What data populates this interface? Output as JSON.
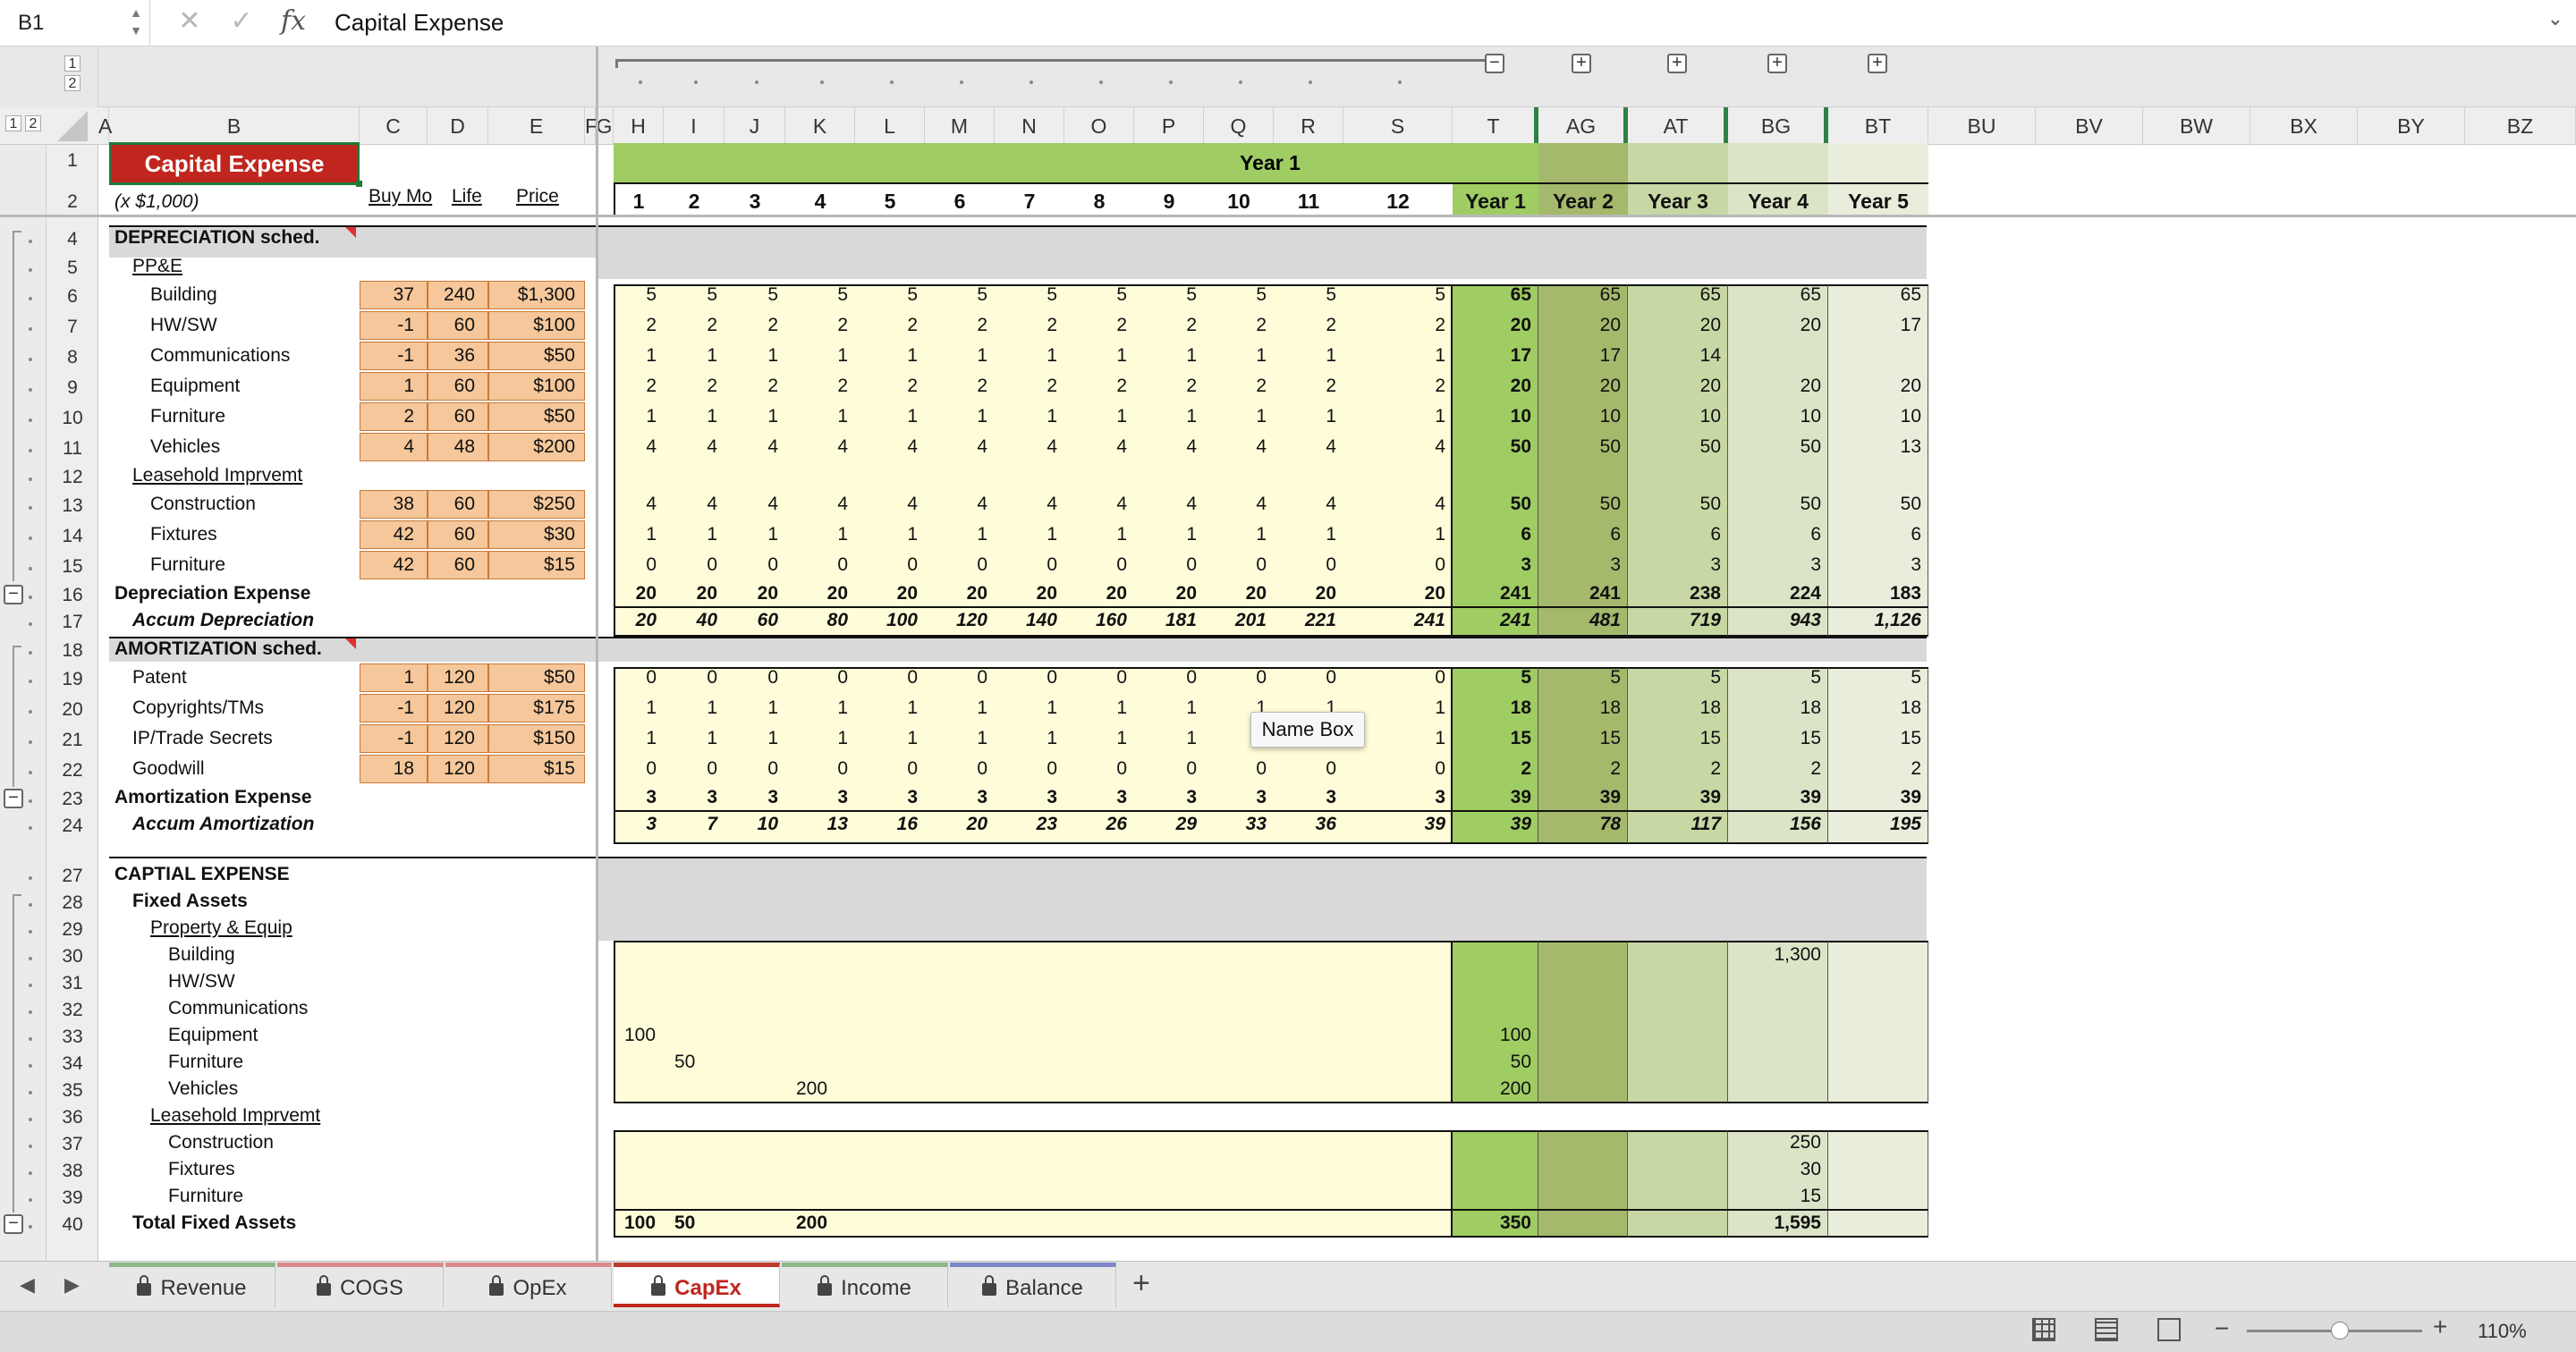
{
  "formula_bar": {
    "name_box": "B1",
    "cancel_icon": "x-icon",
    "enter_icon": "check-icon",
    "fx_label": "fx",
    "content": "Capital Expense"
  },
  "outline_levels": [
    "1",
    "2"
  ],
  "columns": [
    "A",
    "B",
    "C",
    "D",
    "E",
    "F",
    "G",
    "H",
    "I",
    "J",
    "K",
    "L",
    "M",
    "N",
    "O",
    "P",
    "Q",
    "R",
    "S",
    "T",
    "AG",
    "AT",
    "BG",
    "BT",
    "BU",
    "BV",
    "BW",
    "BX",
    "BY",
    "BZ"
  ],
  "rows": [
    "1",
    "2",
    "4",
    "5",
    "6",
    "7",
    "8",
    "9",
    "10",
    "11",
    "12",
    "13",
    "14",
    "15",
    "16",
    "17",
    "18",
    "19",
    "20",
    "21",
    "22",
    "23",
    "24",
    "27",
    "28",
    "29",
    "30",
    "31",
    "32",
    "33",
    "34",
    "35",
    "36",
    "37",
    "38",
    "39",
    "40"
  ],
  "header": {
    "title": "Capital Expense",
    "subtitle": "(x $1,000)",
    "col_buy": "Buy Mo",
    "col_life": "Life",
    "col_price": "Price",
    "year1_banner": "Year 1",
    "months": [
      "1",
      "2",
      "3",
      "4",
      "5",
      "6",
      "7",
      "8",
      "9",
      "10",
      "11",
      "12"
    ],
    "years": [
      "Year 1",
      "Year 2",
      "Year 3",
      "Year 4",
      "Year 5"
    ]
  },
  "depreciation": {
    "section": "DEPRECIATION sched.",
    "ppe_label": "PP&E",
    "leasehold_label": "Leasehold Imprvemt",
    "items": [
      {
        "row": "6",
        "label": "Building",
        "buy": "37",
        "life": "240",
        "price": "$1,300",
        "m": [
          "5",
          "5",
          "5",
          "5",
          "5",
          "5",
          "5",
          "5",
          "5",
          "5",
          "5",
          "5"
        ],
        "y": [
          "65",
          "65",
          "65",
          "65",
          "65"
        ]
      },
      {
        "row": "7",
        "label": "HW/SW",
        "buy": "-1",
        "life": "60",
        "price": "$100",
        "m": [
          "2",
          "2",
          "2",
          "2",
          "2",
          "2",
          "2",
          "2",
          "2",
          "2",
          "2",
          "2"
        ],
        "y": [
          "20",
          "20",
          "20",
          "20",
          "17"
        ]
      },
      {
        "row": "8",
        "label": "Communications",
        "buy": "-1",
        "life": "36",
        "price": "$50",
        "m": [
          "1",
          "1",
          "1",
          "1",
          "1",
          "1",
          "1",
          "1",
          "1",
          "1",
          "1",
          "1"
        ],
        "y": [
          "17",
          "17",
          "14",
          "",
          ""
        ]
      },
      {
        "row": "9",
        "label": "Equipment",
        "buy": "1",
        "life": "60",
        "price": "$100",
        "m": [
          "2",
          "2",
          "2",
          "2",
          "2",
          "2",
          "2",
          "2",
          "2",
          "2",
          "2",
          "2"
        ],
        "y": [
          "20",
          "20",
          "20",
          "20",
          "20"
        ]
      },
      {
        "row": "10",
        "label": "Furniture",
        "buy": "2",
        "life": "60",
        "price": "$50",
        "m": [
          "1",
          "1",
          "1",
          "1",
          "1",
          "1",
          "1",
          "1",
          "1",
          "1",
          "1",
          "1"
        ],
        "y": [
          "10",
          "10",
          "10",
          "10",
          "10"
        ]
      },
      {
        "row": "11",
        "label": "Vehicles",
        "buy": "4",
        "life": "48",
        "price": "$200",
        "m": [
          "4",
          "4",
          "4",
          "4",
          "4",
          "4",
          "4",
          "4",
          "4",
          "4",
          "4",
          "4"
        ],
        "y": [
          "50",
          "50",
          "50",
          "50",
          "13"
        ]
      },
      {
        "row": "13",
        "label": "Construction",
        "buy": "38",
        "life": "60",
        "price": "$250",
        "m": [
          "4",
          "4",
          "4",
          "4",
          "4",
          "4",
          "4",
          "4",
          "4",
          "4",
          "4",
          "4"
        ],
        "y": [
          "50",
          "50",
          "50",
          "50",
          "50"
        ]
      },
      {
        "row": "14",
        "label": "Fixtures",
        "buy": "42",
        "life": "60",
        "price": "$30",
        "m": [
          "1",
          "1",
          "1",
          "1",
          "1",
          "1",
          "1",
          "1",
          "1",
          "1",
          "1",
          "1"
        ],
        "y": [
          "6",
          "6",
          "6",
          "6",
          "6"
        ]
      },
      {
        "row": "15",
        "label": "Furniture",
        "buy": "42",
        "life": "60",
        "price": "$15",
        "m": [
          "0",
          "0",
          "0",
          "0",
          "0",
          "0",
          "0",
          "0",
          "0",
          "0",
          "0",
          "0"
        ],
        "y": [
          "3",
          "3",
          "3",
          "3",
          "3"
        ]
      }
    ],
    "total": {
      "label": "Depreciation Expense",
      "m": [
        "20",
        "20",
        "20",
        "20",
        "20",
        "20",
        "20",
        "20",
        "20",
        "20",
        "20",
        "20"
      ],
      "y": [
        "241",
        "241",
        "238",
        "224",
        "183"
      ]
    },
    "accum": {
      "label": "Accum Depreciation",
      "m": [
        "20",
        "40",
        "60",
        "80",
        "100",
        "120",
        "140",
        "160",
        "181",
        "201",
        "221",
        "241"
      ],
      "y": [
        "241",
        "481",
        "719",
        "943",
        "1,126"
      ]
    }
  },
  "amortization": {
    "section": "AMORTIZATION sched.",
    "items": [
      {
        "row": "19",
        "label": "Patent",
        "buy": "1",
        "life": "120",
        "price": "$50",
        "m": [
          "0",
          "0",
          "0",
          "0",
          "0",
          "0",
          "0",
          "0",
          "0",
          "0",
          "0",
          "0"
        ],
        "y": [
          "5",
          "5",
          "5",
          "5",
          "5"
        ]
      },
      {
        "row": "20",
        "label": "Copyrights/TMs",
        "buy": "-1",
        "life": "120",
        "price": "$175",
        "m": [
          "1",
          "1",
          "1",
          "1",
          "1",
          "1",
          "1",
          "1",
          "1",
          "1",
          "1",
          "1"
        ],
        "y": [
          "18",
          "18",
          "18",
          "18",
          "18"
        ]
      },
      {
        "row": "21",
        "label": "IP/Trade Secrets",
        "buy": "-1",
        "life": "120",
        "price": "$150",
        "m": [
          "1",
          "1",
          "1",
          "1",
          "1",
          "1",
          "1",
          "1",
          "1",
          "1",
          "1",
          "1"
        ],
        "y": [
          "15",
          "15",
          "15",
          "15",
          "15"
        ]
      },
      {
        "row": "22",
        "label": "Goodwill",
        "buy": "18",
        "life": "120",
        "price": "$15",
        "m": [
          "0",
          "0",
          "0",
          "0",
          "0",
          "0",
          "0",
          "0",
          "0",
          "0",
          "0",
          "0"
        ],
        "y": [
          "2",
          "2",
          "2",
          "2",
          "2"
        ]
      }
    ],
    "total": {
      "label": "Amortization Expense",
      "m": [
        "3",
        "3",
        "3",
        "3",
        "3",
        "3",
        "3",
        "3",
        "3",
        "3",
        "3",
        "3"
      ],
      "y": [
        "39",
        "39",
        "39",
        "39",
        "39"
      ]
    },
    "accum": {
      "label": "Accum Amortization",
      "m": [
        "3",
        "7",
        "10",
        "13",
        "16",
        "20",
        "23",
        "26",
        "29",
        "33",
        "36",
        "39"
      ],
      "y": [
        "39",
        "78",
        "117",
        "156",
        "195"
      ]
    }
  },
  "capex": {
    "section": "CAPTIAL EXPENSE",
    "fixed_assets": "Fixed Assets",
    "property_equip": "Property & Equip",
    "leasehold": "Leasehold Imprvemt",
    "items": [
      {
        "row": "30",
        "label": "Building",
        "m1": "",
        "m2": "",
        "m4": "",
        "y1": "",
        "y4": "1,300"
      },
      {
        "row": "31",
        "label": "HW/SW",
        "m1": "",
        "m2": "",
        "m4": "",
        "y1": "",
        "y4": ""
      },
      {
        "row": "32",
        "label": "Communications",
        "m1": "",
        "m2": "",
        "m4": "",
        "y1": "",
        "y4": ""
      },
      {
        "row": "33",
        "label": "Equipment",
        "m1": "100",
        "m2": "",
        "m4": "",
        "y1": "100",
        "y4": ""
      },
      {
        "row": "34",
        "label": "Furniture",
        "m1": "",
        "m2": "50",
        "m4": "",
        "y1": "50",
        "y4": ""
      },
      {
        "row": "35",
        "label": "Vehicles",
        "m1": "",
        "m2": "",
        "m4": "200",
        "y1": "200",
        "y4": ""
      },
      {
        "row": "37",
        "label": "Construction",
        "m1": "",
        "m2": "",
        "m4": "",
        "y1": "",
        "y4": "250"
      },
      {
        "row": "38",
        "label": "Fixtures",
        "m1": "",
        "m2": "",
        "m4": "",
        "y1": "",
        "y4": "30"
      },
      {
        "row": "39",
        "label": "Furniture",
        "m1": "",
        "m2": "",
        "m4": "",
        "y1": "",
        "y4": "15"
      }
    ],
    "total": {
      "label": "Total Fixed Assets",
      "m1": "100",
      "m2": "50",
      "m4": "200",
      "y1": "350",
      "y4": "1,595"
    }
  },
  "tooltip": "Name Box",
  "tabs": [
    {
      "label": "Revenue",
      "color": "#8ab88a",
      "active": false
    },
    {
      "label": "COGS",
      "color": "#d98a8a",
      "active": false
    },
    {
      "label": "OpEx",
      "color": "#d98a8a",
      "active": false
    },
    {
      "label": "CapEx",
      "color": "#c0392b",
      "active": true
    },
    {
      "label": "Income",
      "color": "#8ab88a",
      "active": false
    },
    {
      "label": "Balance",
      "color": "#7f86c9",
      "active": false
    }
  ],
  "add_sheet": "+",
  "status": {
    "zoom": "110%",
    "zoom_fraction": 0.48
  },
  "colors": {
    "title_red": "#c0261e",
    "accent_green": "#2f8047"
  }
}
